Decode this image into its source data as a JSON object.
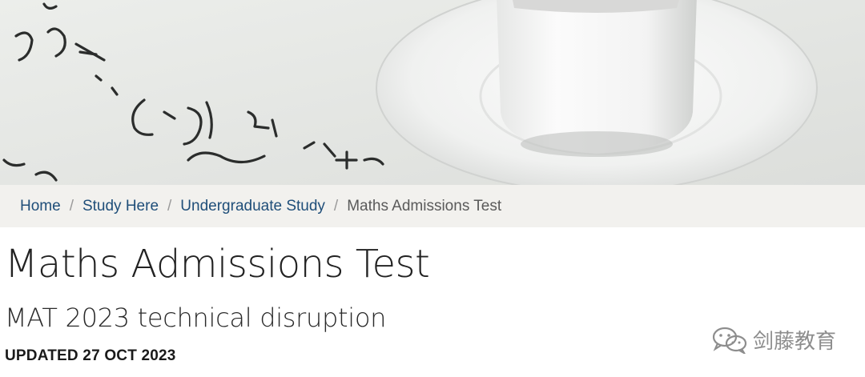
{
  "breadcrumb": {
    "items": [
      {
        "label": "Home"
      },
      {
        "label": "Study Here"
      },
      {
        "label": "Undergraduate Study"
      }
    ],
    "current": "Maths Admissions Test",
    "separator": "/"
  },
  "page": {
    "title": "Maths Admissions Test",
    "subtitle": "MAT 2023 technical disruption",
    "updated": "UPDATED 27 OCT 2023"
  },
  "watermark": {
    "text": "剑藤教育",
    "icon": "wechat-icon"
  },
  "colors": {
    "link": "#1f4e79",
    "breadcrumb_bg": "#f2f1ee",
    "hero_bg": "#e7e8e5"
  }
}
